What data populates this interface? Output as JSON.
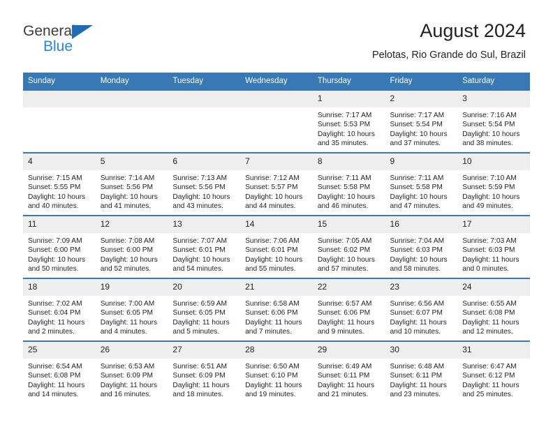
{
  "brand": {
    "name_top": "General",
    "name_bottom": "Blue",
    "triangle_color": "#1f6cb4",
    "blue_text_color": "#2288dd"
  },
  "header": {
    "title": "August 2024",
    "subtitle": "Pelotas, Rio Grande do Sul, Brazil"
  },
  "theme": {
    "header_bg": "#3878b4",
    "daynum_bg": "#efefef",
    "row_border": "#3878b4",
    "text": "#231f20"
  },
  "weekdays": [
    "Sunday",
    "Monday",
    "Tuesday",
    "Wednesday",
    "Thursday",
    "Friday",
    "Saturday"
  ],
  "weeks": [
    [
      {
        "day": "",
        "sunrise": "",
        "sunset": "",
        "daylight_line1": "",
        "daylight_line2": ""
      },
      {
        "day": "",
        "sunrise": "",
        "sunset": "",
        "daylight_line1": "",
        "daylight_line2": ""
      },
      {
        "day": "",
        "sunrise": "",
        "sunset": "",
        "daylight_line1": "",
        "daylight_line2": ""
      },
      {
        "day": "",
        "sunrise": "",
        "sunset": "",
        "daylight_line1": "",
        "daylight_line2": ""
      },
      {
        "day": "1",
        "sunrise": "Sunrise: 7:17 AM",
        "sunset": "Sunset: 5:53 PM",
        "daylight_line1": "Daylight: 10 hours",
        "daylight_line2": "and 35 minutes."
      },
      {
        "day": "2",
        "sunrise": "Sunrise: 7:17 AM",
        "sunset": "Sunset: 5:54 PM",
        "daylight_line1": "Daylight: 10 hours",
        "daylight_line2": "and 37 minutes."
      },
      {
        "day": "3",
        "sunrise": "Sunrise: 7:16 AM",
        "sunset": "Sunset: 5:54 PM",
        "daylight_line1": "Daylight: 10 hours",
        "daylight_line2": "and 38 minutes."
      }
    ],
    [
      {
        "day": "4",
        "sunrise": "Sunrise: 7:15 AM",
        "sunset": "Sunset: 5:55 PM",
        "daylight_line1": "Daylight: 10 hours",
        "daylight_line2": "and 40 minutes."
      },
      {
        "day": "5",
        "sunrise": "Sunrise: 7:14 AM",
        "sunset": "Sunset: 5:56 PM",
        "daylight_line1": "Daylight: 10 hours",
        "daylight_line2": "and 41 minutes."
      },
      {
        "day": "6",
        "sunrise": "Sunrise: 7:13 AM",
        "sunset": "Sunset: 5:56 PM",
        "daylight_line1": "Daylight: 10 hours",
        "daylight_line2": "and 43 minutes."
      },
      {
        "day": "7",
        "sunrise": "Sunrise: 7:12 AM",
        "sunset": "Sunset: 5:57 PM",
        "daylight_line1": "Daylight: 10 hours",
        "daylight_line2": "and 44 minutes."
      },
      {
        "day": "8",
        "sunrise": "Sunrise: 7:11 AM",
        "sunset": "Sunset: 5:58 PM",
        "daylight_line1": "Daylight: 10 hours",
        "daylight_line2": "and 46 minutes."
      },
      {
        "day": "9",
        "sunrise": "Sunrise: 7:11 AM",
        "sunset": "Sunset: 5:58 PM",
        "daylight_line1": "Daylight: 10 hours",
        "daylight_line2": "and 47 minutes."
      },
      {
        "day": "10",
        "sunrise": "Sunrise: 7:10 AM",
        "sunset": "Sunset: 5:59 PM",
        "daylight_line1": "Daylight: 10 hours",
        "daylight_line2": "and 49 minutes."
      }
    ],
    [
      {
        "day": "11",
        "sunrise": "Sunrise: 7:09 AM",
        "sunset": "Sunset: 6:00 PM",
        "daylight_line1": "Daylight: 10 hours",
        "daylight_line2": "and 50 minutes."
      },
      {
        "day": "12",
        "sunrise": "Sunrise: 7:08 AM",
        "sunset": "Sunset: 6:00 PM",
        "daylight_line1": "Daylight: 10 hours",
        "daylight_line2": "and 52 minutes."
      },
      {
        "day": "13",
        "sunrise": "Sunrise: 7:07 AM",
        "sunset": "Sunset: 6:01 PM",
        "daylight_line1": "Daylight: 10 hours",
        "daylight_line2": "and 54 minutes."
      },
      {
        "day": "14",
        "sunrise": "Sunrise: 7:06 AM",
        "sunset": "Sunset: 6:01 PM",
        "daylight_line1": "Daylight: 10 hours",
        "daylight_line2": "and 55 minutes."
      },
      {
        "day": "15",
        "sunrise": "Sunrise: 7:05 AM",
        "sunset": "Sunset: 6:02 PM",
        "daylight_line1": "Daylight: 10 hours",
        "daylight_line2": "and 57 minutes."
      },
      {
        "day": "16",
        "sunrise": "Sunrise: 7:04 AM",
        "sunset": "Sunset: 6:03 PM",
        "daylight_line1": "Daylight: 10 hours",
        "daylight_line2": "and 58 minutes."
      },
      {
        "day": "17",
        "sunrise": "Sunrise: 7:03 AM",
        "sunset": "Sunset: 6:03 PM",
        "daylight_line1": "Daylight: 11 hours",
        "daylight_line2": "and 0 minutes."
      }
    ],
    [
      {
        "day": "18",
        "sunrise": "Sunrise: 7:02 AM",
        "sunset": "Sunset: 6:04 PM",
        "daylight_line1": "Daylight: 11 hours",
        "daylight_line2": "and 2 minutes."
      },
      {
        "day": "19",
        "sunrise": "Sunrise: 7:00 AM",
        "sunset": "Sunset: 6:05 PM",
        "daylight_line1": "Daylight: 11 hours",
        "daylight_line2": "and 4 minutes."
      },
      {
        "day": "20",
        "sunrise": "Sunrise: 6:59 AM",
        "sunset": "Sunset: 6:05 PM",
        "daylight_line1": "Daylight: 11 hours",
        "daylight_line2": "and 5 minutes."
      },
      {
        "day": "21",
        "sunrise": "Sunrise: 6:58 AM",
        "sunset": "Sunset: 6:06 PM",
        "daylight_line1": "Daylight: 11 hours",
        "daylight_line2": "and 7 minutes."
      },
      {
        "day": "22",
        "sunrise": "Sunrise: 6:57 AM",
        "sunset": "Sunset: 6:06 PM",
        "daylight_line1": "Daylight: 11 hours",
        "daylight_line2": "and 9 minutes."
      },
      {
        "day": "23",
        "sunrise": "Sunrise: 6:56 AM",
        "sunset": "Sunset: 6:07 PM",
        "daylight_line1": "Daylight: 11 hours",
        "daylight_line2": "and 10 minutes."
      },
      {
        "day": "24",
        "sunrise": "Sunrise: 6:55 AM",
        "sunset": "Sunset: 6:08 PM",
        "daylight_line1": "Daylight: 11 hours",
        "daylight_line2": "and 12 minutes."
      }
    ],
    [
      {
        "day": "25",
        "sunrise": "Sunrise: 6:54 AM",
        "sunset": "Sunset: 6:08 PM",
        "daylight_line1": "Daylight: 11 hours",
        "daylight_line2": "and 14 minutes."
      },
      {
        "day": "26",
        "sunrise": "Sunrise: 6:53 AM",
        "sunset": "Sunset: 6:09 PM",
        "daylight_line1": "Daylight: 11 hours",
        "daylight_line2": "and 16 minutes."
      },
      {
        "day": "27",
        "sunrise": "Sunrise: 6:51 AM",
        "sunset": "Sunset: 6:09 PM",
        "daylight_line1": "Daylight: 11 hours",
        "daylight_line2": "and 18 minutes."
      },
      {
        "day": "28",
        "sunrise": "Sunrise: 6:50 AM",
        "sunset": "Sunset: 6:10 PM",
        "daylight_line1": "Daylight: 11 hours",
        "daylight_line2": "and 19 minutes."
      },
      {
        "day": "29",
        "sunrise": "Sunrise: 6:49 AM",
        "sunset": "Sunset: 6:11 PM",
        "daylight_line1": "Daylight: 11 hours",
        "daylight_line2": "and 21 minutes."
      },
      {
        "day": "30",
        "sunrise": "Sunrise: 6:48 AM",
        "sunset": "Sunset: 6:11 PM",
        "daylight_line1": "Daylight: 11 hours",
        "daylight_line2": "and 23 minutes."
      },
      {
        "day": "31",
        "sunrise": "Sunrise: 6:47 AM",
        "sunset": "Sunset: 6:12 PM",
        "daylight_line1": "Daylight: 11 hours",
        "daylight_line2": "and 25 minutes."
      }
    ]
  ]
}
